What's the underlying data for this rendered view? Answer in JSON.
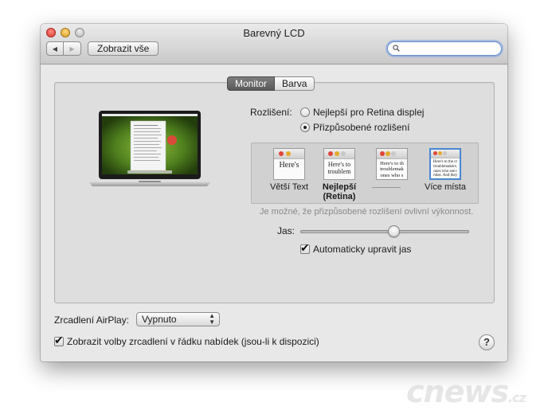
{
  "window": {
    "title": "Barevný LCD"
  },
  "toolbar": {
    "show_all_label": "Zobrazit vše",
    "back_glyph": "◀",
    "forward_glyph": "▶"
  },
  "search": {
    "value": "",
    "placeholder": ""
  },
  "tabs": [
    {
      "label": "Monitor",
      "active": true
    },
    {
      "label": "Barva",
      "active": false
    }
  ],
  "resolution": {
    "label": "Rozlišení:",
    "options": [
      {
        "label": "Nejlepší pro Retina displej",
        "selected": false
      },
      {
        "label": "Přizpůsobené rozlišení",
        "selected": true
      }
    ],
    "scaled": [
      {
        "label": "Větší Text",
        "sample": "Here's",
        "selected": false
      },
      {
        "label": "Nejlepší\n(Retina)",
        "sample": "Here's to\ntroublem",
        "selected": false
      },
      {
        "label": "",
        "sample": "Here's to th\ntroublemak\nones who s",
        "selected": false
      },
      {
        "label": "Více místa",
        "sample": "Here's to the cr\ntroublemakers.\nones who see t\nrules. And they",
        "selected": true
      }
    ],
    "note": "Je možné, že přizpůsobené rozlišení ovlivní výkonnost."
  },
  "brightness": {
    "label": "Jas:",
    "value": 0.55,
    "auto_label": "Automaticky upravit jas",
    "auto_checked": true
  },
  "airplay": {
    "label": "Zrcadlení AirPlay:",
    "selected": "Vypnuto",
    "show_in_menu_label": "Zobrazit volby zrcadlení v řádku nabídek (jsou-li k dispozici)",
    "show_in_menu_checked": true
  },
  "help": {
    "glyph": "?"
  },
  "watermark": {
    "text": "cnews",
    "suffix": ".cz"
  },
  "colors": {
    "close": "#e0443a",
    "minimize": "#e6a92a",
    "accent": "#4a86d4"
  }
}
